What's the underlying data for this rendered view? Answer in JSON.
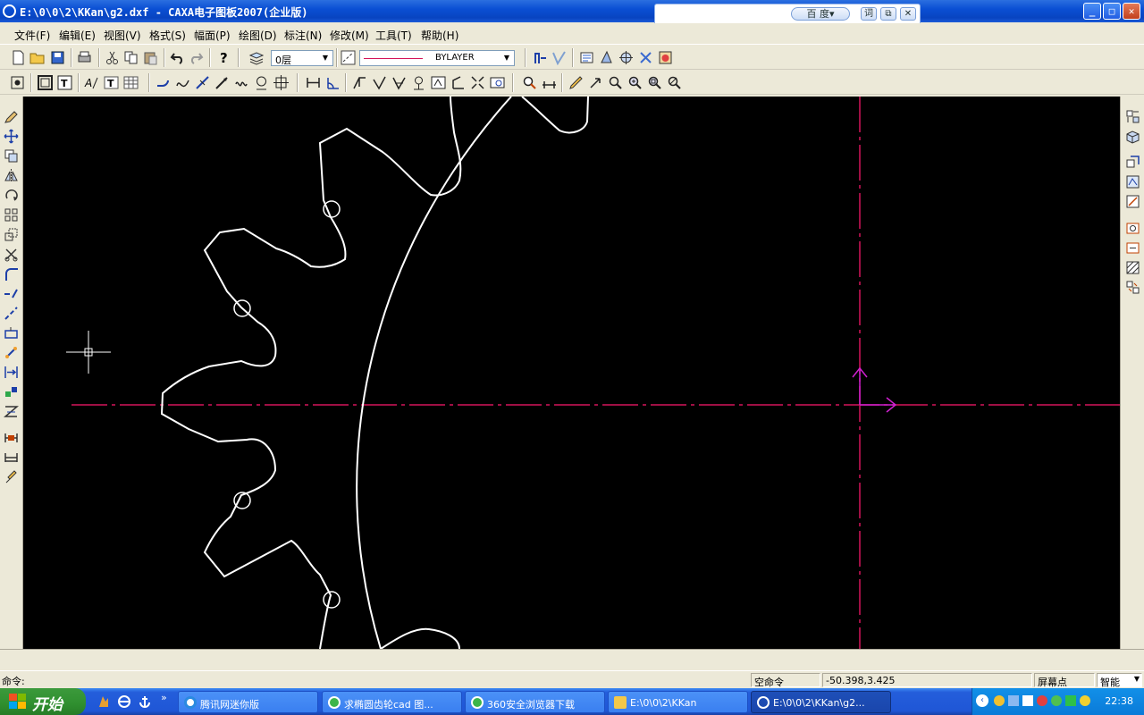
{
  "window": {
    "title": "E:\\0\\0\\2\\KKan\\g2.dxf - CAXA电子图板2007(企业版)",
    "controls": {
      "minimize": "_",
      "maximize": "□",
      "close": "✕"
    }
  },
  "baidu_bar": {
    "button": "百 度▾",
    "word": "词",
    "copy": "⧉",
    "close": "✕"
  },
  "menu": [
    "文件(F)",
    "编辑(E)",
    "视图(V)",
    "格式(S)",
    "幅面(P)",
    "绘图(D)",
    "标注(N)",
    "修改(M)",
    "工具(T)",
    "帮助(H)"
  ],
  "properties": {
    "layer": "0层",
    "linetype": "BYLAYER"
  },
  "command": {
    "prompt": "命令:"
  },
  "status": {
    "command_state": "空命令",
    "coords": "-50.398,3.425",
    "snap_label": "屏幕点",
    "snap_mode": "智能"
  },
  "taskbar": {
    "start": "开始",
    "tasks": [
      {
        "label": "腾讯网迷你版"
      },
      {
        "label": "求椭圆齿轮cad 图..."
      },
      {
        "label": "360安全浏览器下载"
      },
      {
        "label": "E:\\0\\0\\2\\KKan"
      },
      {
        "label": "E:\\0\\0\\2\\KKan\\g2..."
      }
    ],
    "clock": "22:38"
  },
  "colors": {
    "canvas": "#000000",
    "geometry": "#ffffff",
    "centerline": "#d4145a",
    "ucs": "#d020d0",
    "titlebar": "#0a4fd4",
    "taskbar": "#245edb"
  }
}
